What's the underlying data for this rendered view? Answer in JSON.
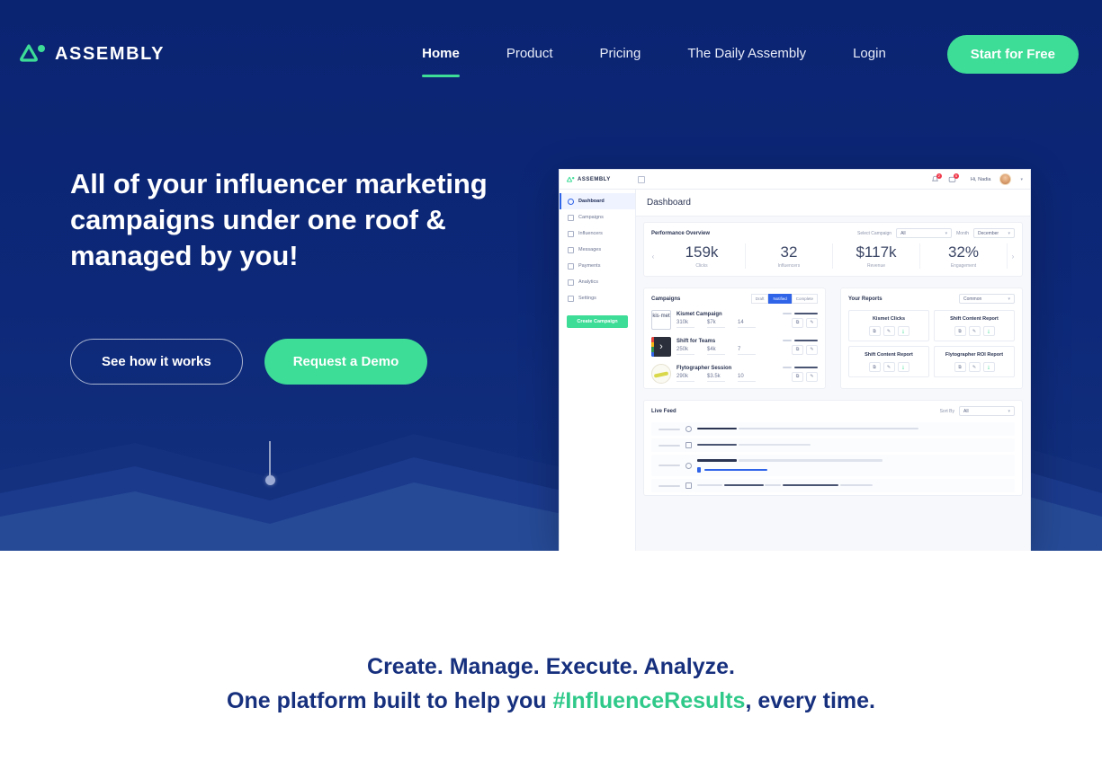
{
  "brand": {
    "name": "ASSEMBLY",
    "logo_icon": "assembly-triangle-logo",
    "accent": "#3ddc97"
  },
  "nav": {
    "items": [
      {
        "label": "Home",
        "active": true
      },
      {
        "label": "Product",
        "active": false
      },
      {
        "label": "Pricing",
        "active": false
      },
      {
        "label": "The Daily Assembly",
        "active": false
      },
      {
        "label": "Login",
        "active": false
      }
    ],
    "cta_label": "Start for Free"
  },
  "hero": {
    "headline": "All of your influencer marketing campaigns under one roof & managed by you!",
    "secondary_button": "See how it works",
    "primary_button": "Request a Demo",
    "background": "#0b2472"
  },
  "dashboard": {
    "brand": "ASSEMBLY",
    "greeting": "Hi, Nadia",
    "notification_counts": [
      "2",
      "5"
    ],
    "page_title": "Dashboard",
    "sidebar": [
      {
        "label": "Dashboard",
        "icon": "gauge-icon",
        "active": true
      },
      {
        "label": "Campaigns",
        "icon": "megaphone-icon",
        "active": false
      },
      {
        "label": "Influencers",
        "icon": "people-icon",
        "active": false
      },
      {
        "label": "Messages",
        "icon": "chat-icon",
        "active": false
      },
      {
        "label": "Payments",
        "icon": "card-icon",
        "active": false
      },
      {
        "label": "Analytics",
        "icon": "bar-chart-icon",
        "active": false
      },
      {
        "label": "Settings",
        "icon": "gear-icon",
        "active": false
      }
    ],
    "create_campaign_label": "Create Campaign",
    "performance": {
      "title": "Performance Overview",
      "select_campaign_label": "Select Campaign",
      "select_campaign_value": "All",
      "month_label": "Month",
      "month_value": "December",
      "stats": [
        {
          "value": "159k",
          "label": "Clicks"
        },
        {
          "value": "32",
          "label": "Influencers"
        },
        {
          "value": "$117k",
          "label": "Revenue"
        },
        {
          "value": "32%",
          "label": "Engagement"
        }
      ]
    },
    "campaigns": {
      "title": "Campaigns",
      "tabs": [
        {
          "label": "Draft",
          "active": false
        },
        {
          "label": "Notified",
          "active": true
        },
        {
          "label": "Complete",
          "active": false
        }
      ],
      "rows": [
        {
          "name": "Kismet Campaign",
          "thumb": "kismet",
          "thumb_text": "kis·met",
          "clicks": "310k",
          "revenue": "$7k",
          "count": "14"
        },
        {
          "name": "Shift for Teams",
          "thumb": "shift",
          "thumb_text": "›",
          "clicks": "250k",
          "revenue": "$4k",
          "count": "7"
        },
        {
          "name": "Flytographer Session",
          "thumb": "fly",
          "thumb_text": "",
          "clicks": "290k",
          "revenue": "$3.5k",
          "count": "10"
        }
      ]
    },
    "reports": {
      "title": "Your Reports",
      "filter_value": "Common",
      "items": [
        {
          "name": "Kismet Clicks"
        },
        {
          "name": "Shift Content Report"
        },
        {
          "name": "Shift Content Report"
        },
        {
          "name": "Flytographer ROI Report"
        }
      ]
    },
    "live_feed": {
      "title": "Live Feed",
      "sort_label": "Sort By",
      "sort_value": "All"
    }
  },
  "tagline": {
    "line1": "Create. Manage. Execute. Analyze.",
    "line2_prefix": "One platform built to help you ",
    "hashtag": "#InfluenceResults",
    "line2_suffix": ", every time.",
    "color": "#17307e",
    "hashtag_color": "#2fc98a"
  }
}
